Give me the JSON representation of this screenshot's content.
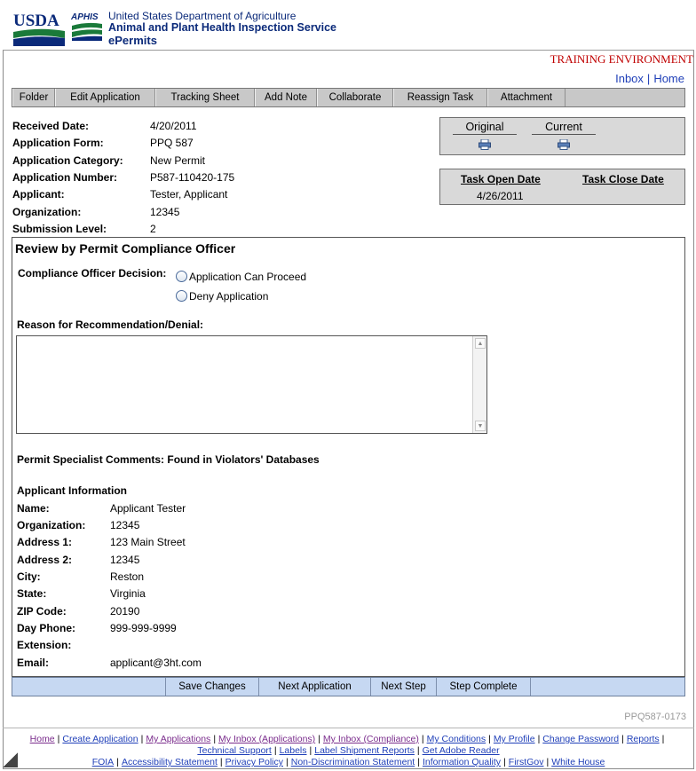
{
  "header": {
    "usda_text": "USDA",
    "aphis_text": "APHIS",
    "org_line1": "United States Department of Agriculture",
    "org_line2": "Animal and Plant Health Inspection Service",
    "org_line3": "ePermits",
    "environment": "TRAINING ENVIRONMENT",
    "links": [
      "Inbox",
      "Home"
    ]
  },
  "menu": [
    "Folder",
    "Edit Application",
    "Tracking Sheet",
    "Add Note",
    "Collaborate",
    "Reassign Task",
    "Attachment"
  ],
  "application": {
    "fields": [
      {
        "label": "Received Date:",
        "value": "4/20/2011"
      },
      {
        "label": "Application Form:",
        "value": "PPQ 587"
      },
      {
        "label": "Application Category:",
        "value": "New Permit"
      },
      {
        "label": "Application Number:",
        "value": "P587-110420-175"
      },
      {
        "label": "Applicant:",
        "value": "Tester, Applicant"
      },
      {
        "label": "Organization:",
        "value": "12345"
      },
      {
        "label": "Submission Level:",
        "value": "2"
      }
    ]
  },
  "versions": {
    "original": "Original",
    "current": "Current"
  },
  "task": {
    "open_label": "Task Open Date",
    "close_label": "Task Close Date",
    "open_date": "4/26/2011",
    "close_date": ""
  },
  "review": {
    "title": "Review by Permit Compliance Officer",
    "decision_label": "Compliance Officer Decision:",
    "options": [
      "Application Can Proceed",
      "Deny Application"
    ],
    "reason_label": "Reason for Recommendation/Denial:",
    "reason_value": "",
    "specialist_comments": "Permit Specialist Comments:  Found in Violators' Databases",
    "applicant_info_title": "Applicant Information",
    "applicant_fields": [
      {
        "label": "Name:",
        "value": "Applicant Tester"
      },
      {
        "label": "Organization:",
        "value": "12345"
      },
      {
        "label": "Address 1:",
        "value": "123 Main Street"
      },
      {
        "label": "Address 2:",
        "value": "12345"
      },
      {
        "label": "City:",
        "value": "Reston"
      },
      {
        "label": "State:",
        "value": "Virginia"
      },
      {
        "label": "ZIP Code:",
        "value": "20190"
      },
      {
        "label": "Day Phone:",
        "value": "999-999-9999"
      },
      {
        "label": "Extension:",
        "value": ""
      },
      {
        "label": "Email:",
        "value": "applicant@3ht.com"
      }
    ]
  },
  "actions": [
    "Save Changes",
    "Next Application",
    "Next Step",
    "Step Complete"
  ],
  "form_code": "PPQ587-0173",
  "footer": {
    "line1": [
      "Home",
      "Create Application",
      "My Applications",
      "My Inbox (Applications)",
      "My Inbox (Compliance)",
      "My Conditions",
      "My Profile",
      "Change Password",
      "Reports"
    ],
    "line2": [
      "Technical Support",
      "Labels",
      "Label Shipment Reports",
      "Get Adobe Reader"
    ],
    "line3": [
      "FOIA",
      "Accessibility Statement",
      "Privacy Policy",
      "Non-Discrimination Statement",
      "Information Quality",
      "FirstGov",
      "White House"
    ]
  },
  "colors": {
    "brand_blue": "#0b2a7a",
    "link_blue": "#1f3fb8",
    "training_red": "#c00000",
    "menu_gray": "#c8c8c8",
    "button_bar_blue": "#c6d8f2"
  }
}
